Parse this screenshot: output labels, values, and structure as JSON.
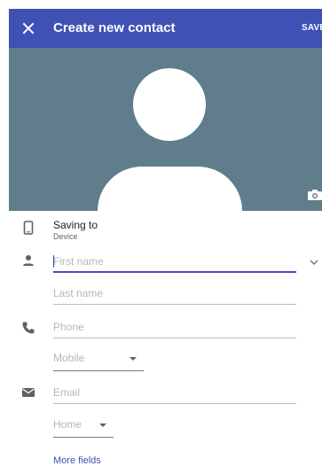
{
  "app_bar": {
    "title": "Create new contact",
    "save_label": "SAVE",
    "background_color": "#3f51b5"
  },
  "photo": {
    "background_color": "#607d8b",
    "icons": [
      "avatar-placeholder",
      "camera-icon"
    ]
  },
  "saving_to": {
    "title": "Saving to",
    "account": "Device"
  },
  "name": {
    "first_name_placeholder": "First name",
    "last_name_placeholder": "Last name"
  },
  "phone": {
    "placeholder": "Phone",
    "type_value": "Mobile"
  },
  "email": {
    "placeholder": "Email",
    "type_value": "Home"
  },
  "more_fields_label": "More fields",
  "accent_color": "#3f51b5"
}
